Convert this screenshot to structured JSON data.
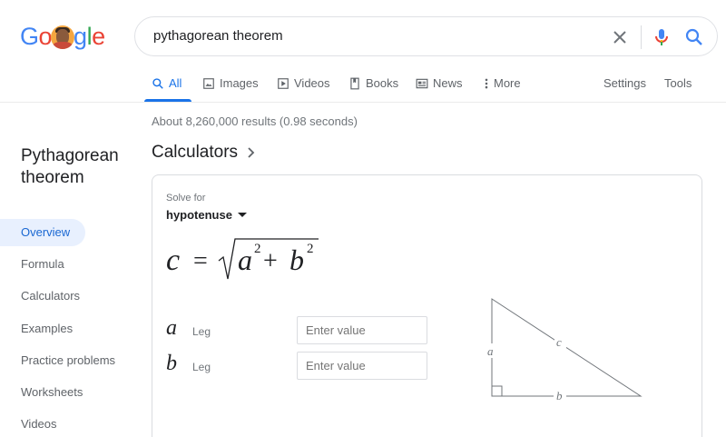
{
  "logo": {
    "letters": [
      "G",
      "o",
      "",
      "g",
      "l",
      "e"
    ],
    "colors": [
      "#4285f4",
      "#ea4335",
      "#fbbc05",
      "#4285f4",
      "#34a853",
      "#ea4335"
    ]
  },
  "search": {
    "query": "pythagorean theorem",
    "icons": [
      "close-icon",
      "microphone-icon",
      "search-icon"
    ]
  },
  "tabs": [
    {
      "label": "All",
      "icon": "search-icon",
      "active": true
    },
    {
      "label": "Images",
      "icon": "image-icon"
    },
    {
      "label": "Videos",
      "icon": "video-icon"
    },
    {
      "label": "Books",
      "icon": "book-icon"
    },
    {
      "label": "News",
      "icon": "news-icon"
    },
    {
      "label": "More",
      "icon": "more-vert-icon"
    }
  ],
  "tools": {
    "settings": "Settings",
    "tools": "Tools"
  },
  "stats": "About 8,260,000 results (0.98 seconds)",
  "knowledge_panel": {
    "title": "Pythagorean theorem",
    "nav": [
      "Overview",
      "Formula",
      "Calculators",
      "Examples",
      "Practice problems",
      "Worksheets",
      "Videos"
    ],
    "active_index": 0
  },
  "calculator": {
    "heading": "Calculators",
    "solve_for_label": "Solve for",
    "solve_for_value": "hypotenuse",
    "formula": {
      "lhs": "c",
      "equals": "=",
      "term1": "a",
      "exp1": "2",
      "plus": "+",
      "term2": "b",
      "exp2": "2"
    },
    "inputs": [
      {
        "var": "a",
        "label": "Leg",
        "placeholder": "Enter value"
      },
      {
        "var": "b",
        "label": "Leg",
        "placeholder": "Enter value"
      }
    ],
    "triangle_labels": {
      "a": "a",
      "b": "b",
      "c": "c"
    }
  },
  "colors": {
    "accent": "#1a73e8",
    "active_bg": "#e8f0fe",
    "text_secondary": "#5f6368"
  }
}
